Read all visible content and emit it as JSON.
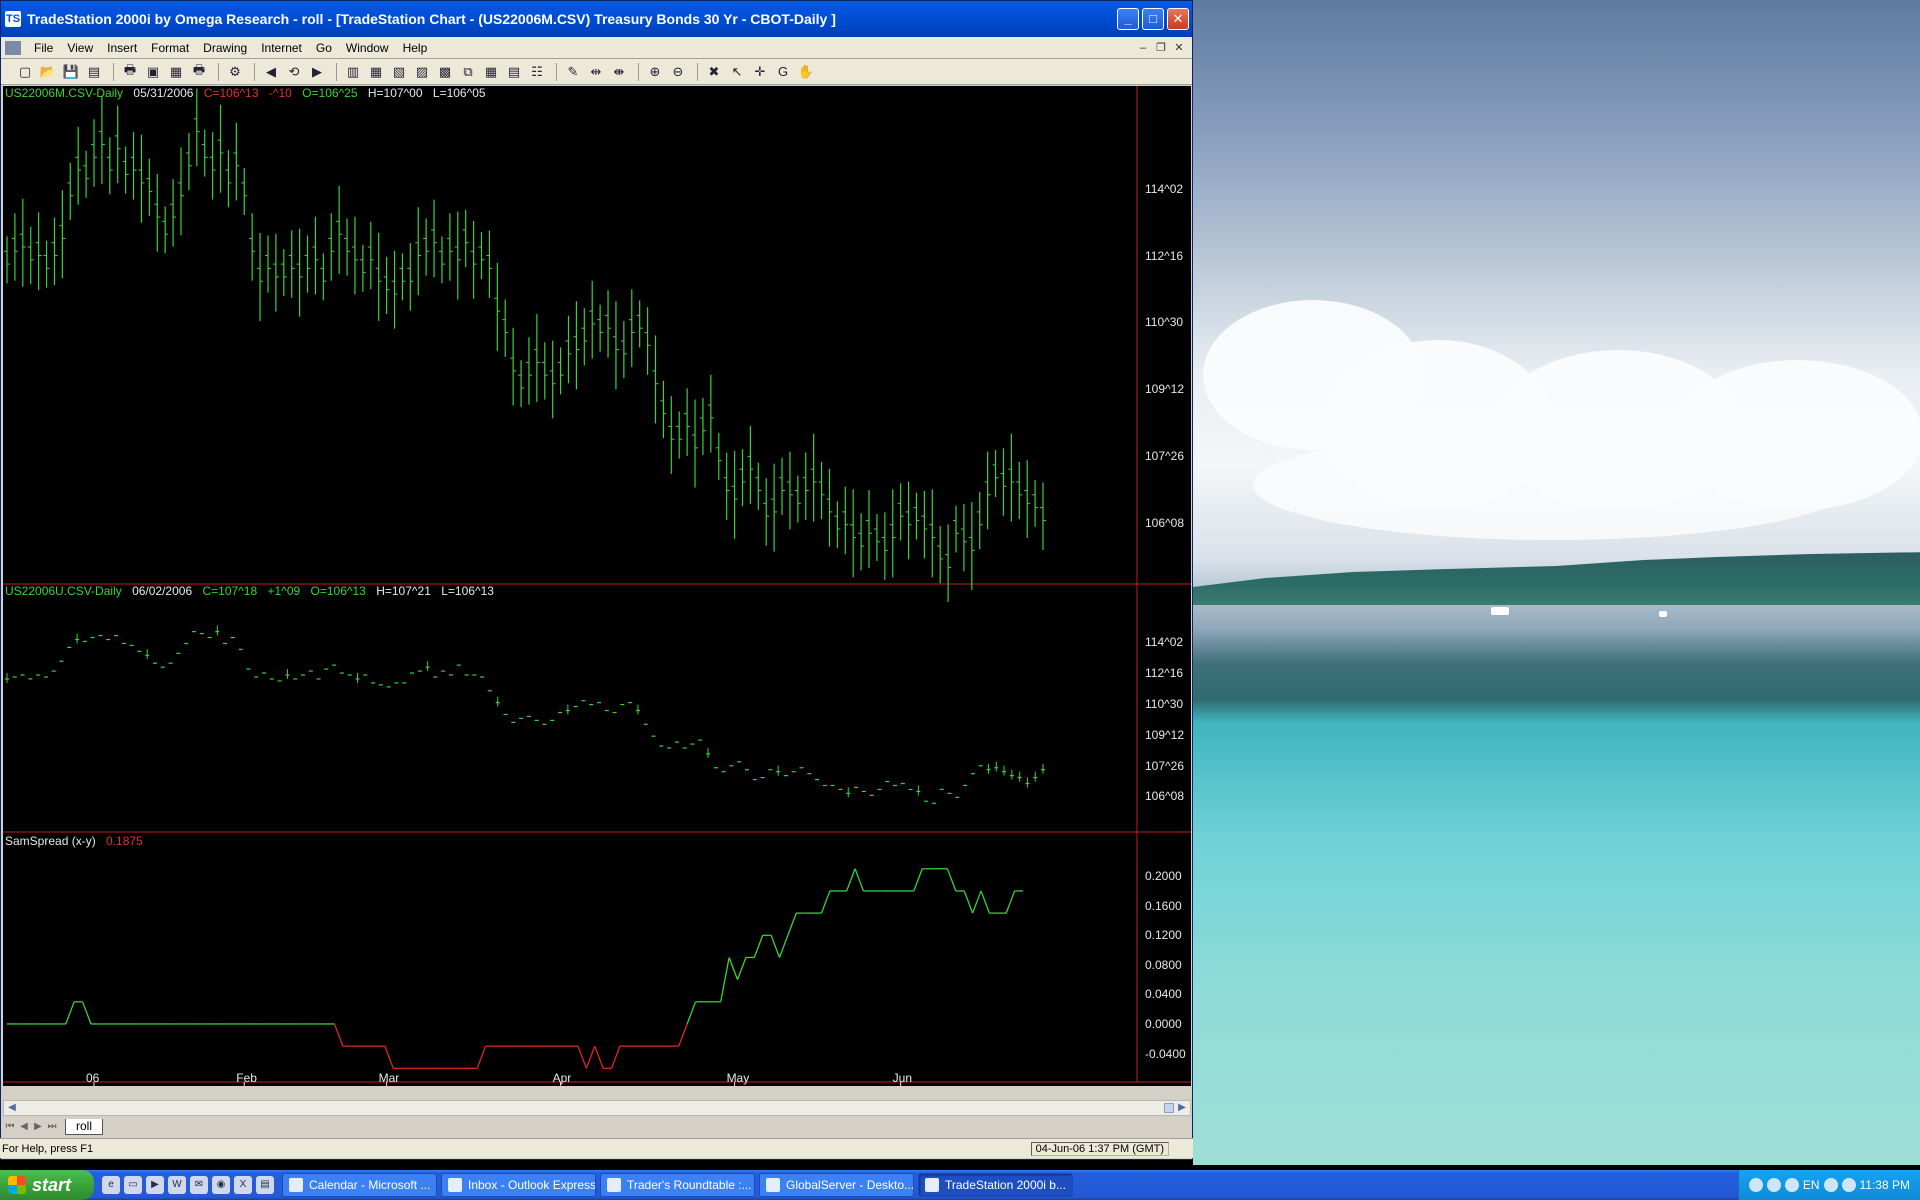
{
  "window": {
    "title": "TradeStation 2000i by Omega Research - roll - [TradeStation Chart - (US22006M.CSV) Treasury Bonds 30 Yr - CBOT-Daily ]",
    "icon_text": "TS"
  },
  "menu": [
    "File",
    "View",
    "Insert",
    "Format",
    "Drawing",
    "Internet",
    "Go",
    "Window",
    "Help"
  ],
  "toolbar_icons": [
    "new-icon",
    "open-icon",
    "save-icon",
    "open-workspace-icon",
    "print-icon",
    "print-preview-icon",
    "page-setup-icon",
    "print2-icon",
    "format-icon",
    "back-icon",
    "refresh-icon",
    "forward-icon",
    "insert-chart-icon",
    "insert-grid-icon",
    "insert-report-icon",
    "insert-strategy-icon",
    "insert-text-icon",
    "window-icon",
    "grid-icon",
    "chart-analysis-icon",
    "data-icon",
    "drawing-icon",
    "bar-spacing-icon",
    "bar-spacing2-icon",
    "zoom-in-icon",
    "zoom-out-icon",
    "tools-icon",
    "pointer-icon",
    "crosshair-icon",
    "go-icon",
    "hand-icon"
  ],
  "charts": {
    "pane1": {
      "symbol": "US22006M.CSV-Daily",
      "date": "05/31/2006",
      "close": "C=106^13",
      "change": "-^10",
      "open": "O=106^25",
      "high": "H=107^00",
      "low": "L=106^05",
      "axis_labels": [
        "114^02",
        "112^16",
        "110^30",
        "109^12",
        "107^26",
        "106^08"
      ]
    },
    "pane2": {
      "symbol": "US22006U.CSV-Daily",
      "date": "06/02/2006",
      "close": "C=107^18",
      "change": "+1^09",
      "open": "O=106^13",
      "high": "H=107^21",
      "low": "L=106^13",
      "axis_labels": [
        "114^02",
        "112^16",
        "110^30",
        "109^12",
        "107^26",
        "106^08"
      ]
    },
    "pane3": {
      "name": "SamSpread (x-y)",
      "value": "0.1875",
      "axis_labels": [
        "0.2000",
        "0.1600",
        "0.1200",
        "0.0800",
        "0.0400",
        "0.0000",
        "-0.0400"
      ]
    },
    "x_labels": [
      "06",
      "Feb",
      "Mar",
      "Apr",
      "May",
      "Jun"
    ]
  },
  "chart_data": [
    {
      "type": "bar",
      "symbol": "US22006M.CSV-Daily",
      "values": [
        112.4,
        112.7,
        112.8,
        112.5,
        112.6,
        112.3,
        112.6,
        113.0,
        114.0,
        114.6,
        114.4,
        114.9,
        115.2,
        114.6,
        115.1,
        114.5,
        114.6,
        114.3,
        114.1,
        113.5,
        113.1,
        113.5,
        114.0,
        114.7,
        115.5,
        114.9,
        114.6,
        115.0,
        114.3,
        114.7,
        114.0,
        112.7,
        112.0,
        112.3,
        112.1,
        112.1,
        112.3,
        112.1,
        112.3,
        112.5,
        112.0,
        112.7,
        113.1,
        112.7,
        112.5,
        112.2,
        112.5,
        112.0,
        111.8,
        111.7,
        112.0,
        112.0,
        112.6,
        112.7,
        112.9,
        112.4,
        112.7,
        112.5,
        112.9,
        112.4,
        112.5,
        112.3,
        111.3,
        110.8,
        109.9,
        109.5,
        109.8,
        110.1,
        109.8,
        109.6,
        109.8,
        110.3,
        110.4,
        110.6,
        111.0,
        110.8,
        110.9,
        110.4,
        110.3,
        110.8,
        110.9,
        110.5,
        109.6,
        108.9,
        108.3,
        108.3,
        108.6,
        108.1,
        108.5,
        108.8,
        107.8,
        107.1,
        106.9,
        107.3,
        107.6,
        107.1,
        106.5,
        106.6,
        107.1,
        107.0,
        106.8,
        107.1,
        107.3,
        107.0,
        106.6,
        106.2,
        106.3,
        106.0,
        105.8,
        106.1,
        105.9,
        105.7,
        106.0,
        106.5,
        106.3,
        106.4,
        106.2,
        106.0,
        105.5,
        105.3,
        106.1,
        105.9,
        105.7,
        106.3,
        107.0,
        107.4,
        107.2,
        107.3,
        107.0,
        106.8,
        106.7,
        106.4
      ],
      "ylim": [
        105.0,
        116.0
      ]
    },
    {
      "type": "bar",
      "symbol": "US22006U.CSV-Daily",
      "values": [
        112.2,
        112.3,
        112.4,
        112.2,
        112.4,
        112.3,
        112.6,
        113.1,
        113.8,
        114.2,
        114.1,
        114.3,
        114.4,
        114.2,
        114.4,
        114.0,
        113.9,
        113.6,
        113.4,
        113.0,
        112.8,
        113.0,
        113.5,
        114.0,
        114.6,
        114.5,
        114.3,
        114.6,
        114.0,
        114.3,
        113.7,
        112.7,
        112.3,
        112.5,
        112.2,
        112.1,
        112.4,
        112.2,
        112.4,
        112.6,
        112.2,
        112.7,
        112.9,
        112.5,
        112.4,
        112.2,
        112.4,
        112.0,
        111.9,
        111.8,
        112.0,
        112.0,
        112.5,
        112.6,
        112.8,
        112.3,
        112.6,
        112.4,
        112.9,
        112.4,
        112.4,
        112.3,
        111.6,
        111.0,
        110.4,
        110.0,
        110.2,
        110.3,
        110.1,
        109.9,
        110.1,
        110.5,
        110.6,
        110.8,
        111.1,
        110.9,
        111.0,
        110.6,
        110.5,
        110.9,
        111.0,
        110.6,
        109.9,
        109.3,
        108.8,
        108.7,
        109.0,
        108.7,
        108.9,
        109.1,
        108.4,
        107.7,
        107.5,
        107.8,
        108.0,
        107.6,
        107.1,
        107.2,
        107.6,
        107.5,
        107.3,
        107.5,
        107.7,
        107.4,
        107.1,
        106.8,
        106.8,
        106.6,
        106.4,
        106.7,
        106.5,
        106.3,
        106.6,
        107.0,
        106.8,
        106.9,
        106.6,
        106.5,
        106.0,
        105.9,
        106.6,
        106.4,
        106.2,
        106.8,
        107.4,
        107.8,
        107.6,
        107.7,
        107.5,
        107.3,
        107.2,
        106.9,
        107.2,
        107.6
      ],
      "ylim": [
        105.0,
        116.0
      ]
    },
    {
      "type": "line",
      "name": "SamSpread (x-y)",
      "values": [
        0.0,
        0.0,
        0.0,
        0.0,
        0.0,
        0.0,
        0.0,
        0.0,
        0.03,
        0.03,
        0.0,
        0.0,
        0.0,
        0.0,
        0.0,
        0.0,
        0.0,
        0.0,
        0.0,
        0.0,
        0.0,
        0.0,
        0.0,
        0.0,
        0.0,
        0.0,
        0.0,
        0.0,
        0.0,
        0.0,
        0.0,
        0.0,
        0.0,
        0.0,
        0.0,
        0.0,
        0.0,
        0.0,
        0.0,
        0.0,
        -0.03,
        -0.03,
        -0.03,
        -0.03,
        -0.03,
        -0.03,
        -0.06,
        -0.06,
        -0.06,
        -0.06,
        -0.06,
        -0.06,
        -0.06,
        -0.06,
        -0.06,
        -0.06,
        -0.06,
        -0.03,
        -0.03,
        -0.03,
        -0.03,
        -0.03,
        -0.03,
        -0.03,
        -0.03,
        -0.03,
        -0.03,
        -0.03,
        -0.03,
        -0.06,
        -0.03,
        -0.06,
        -0.06,
        -0.03,
        -0.03,
        -0.03,
        -0.03,
        -0.03,
        -0.03,
        -0.03,
        -0.03,
        0.0,
        0.03,
        0.03,
        0.03,
        0.03,
        0.09,
        0.06,
        0.09,
        0.09,
        0.12,
        0.12,
        0.09,
        0.12,
        0.15,
        0.15,
        0.15,
        0.15,
        0.18,
        0.18,
        0.18,
        0.21,
        0.18,
        0.18,
        0.18,
        0.18,
        0.18,
        0.18,
        0.18,
        0.21,
        0.21,
        0.21,
        0.21,
        0.18,
        0.18,
        0.15,
        0.18,
        0.15,
        0.15,
        0.15,
        0.18,
        0.18
      ],
      "ylim": [
        -0.065,
        0.23
      ]
    }
  ],
  "tab": {
    "label": "roll"
  },
  "status": {
    "help": "For Help, press F1",
    "time": "04-Jun-06 1:37 PM (GMT)"
  },
  "taskbar": {
    "start_label": "start",
    "tasks": [
      "Calendar - Microsoft ...",
      "Inbox - Outlook Express",
      "Trader's Roundtable :...",
      "GlobalServer - Deskto...",
      "TradeStation 2000i b..."
    ],
    "tray_lang": "EN",
    "clock": "11:38 PM"
  }
}
